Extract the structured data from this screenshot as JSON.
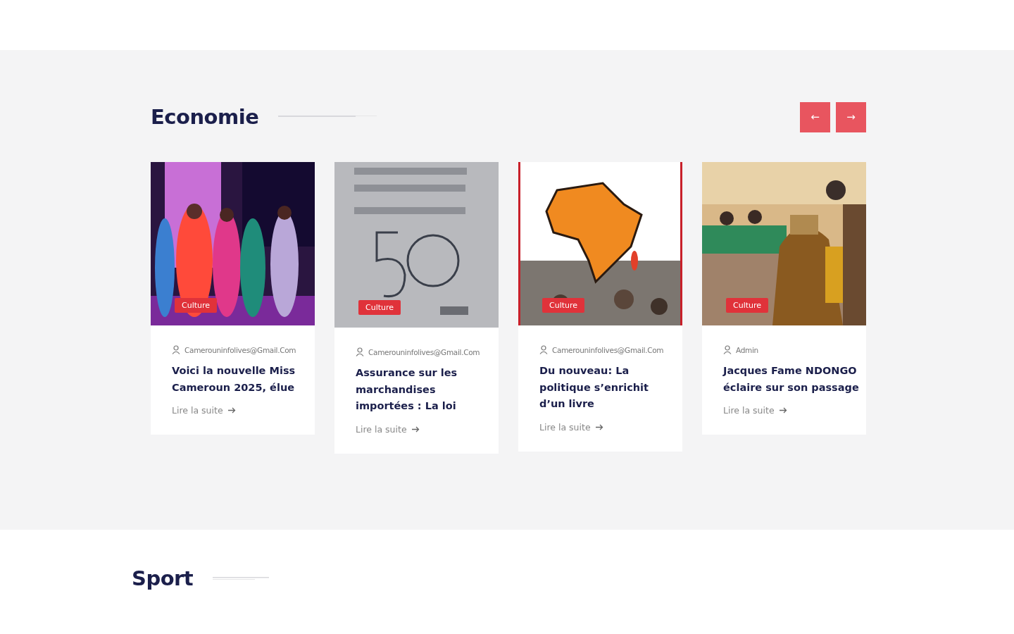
{
  "sections": [
    {
      "title": "Economie",
      "nav": {
        "prev": "←",
        "next": "→"
      },
      "cards": [
        {
          "category": "Culture",
          "author": "Camerouninfolives@Gmail.Com",
          "title": "Voici la nouvelle Miss Cameroun 2025, élue",
          "link": "Lire la suite",
          "picture": {
            "kind": "stage"
          }
        },
        {
          "category": "Culture",
          "author": "Camerouninfolives@Gmail.Com",
          "title": "Assurance sur les marchandises importées : La loi",
          "link": "Lire la suite",
          "picture": {
            "kind": "poster"
          }
        },
        {
          "category": "Culture",
          "author": "Camerouninfolives@Gmail.Com",
          "title": "Du nouveau: La politique s’enrichit d’un livre",
          "link": "Lire la suite",
          "picture": {
            "kind": "map"
          }
        },
        {
          "category": "Culture",
          "author": "Admin",
          "title": "Jacques Fame NDONGO éclaire sur son passage",
          "link": "Lire la suite",
          "picture": {
            "kind": "ceremony"
          }
        }
      ]
    },
    {
      "title": "Sport"
    }
  ]
}
